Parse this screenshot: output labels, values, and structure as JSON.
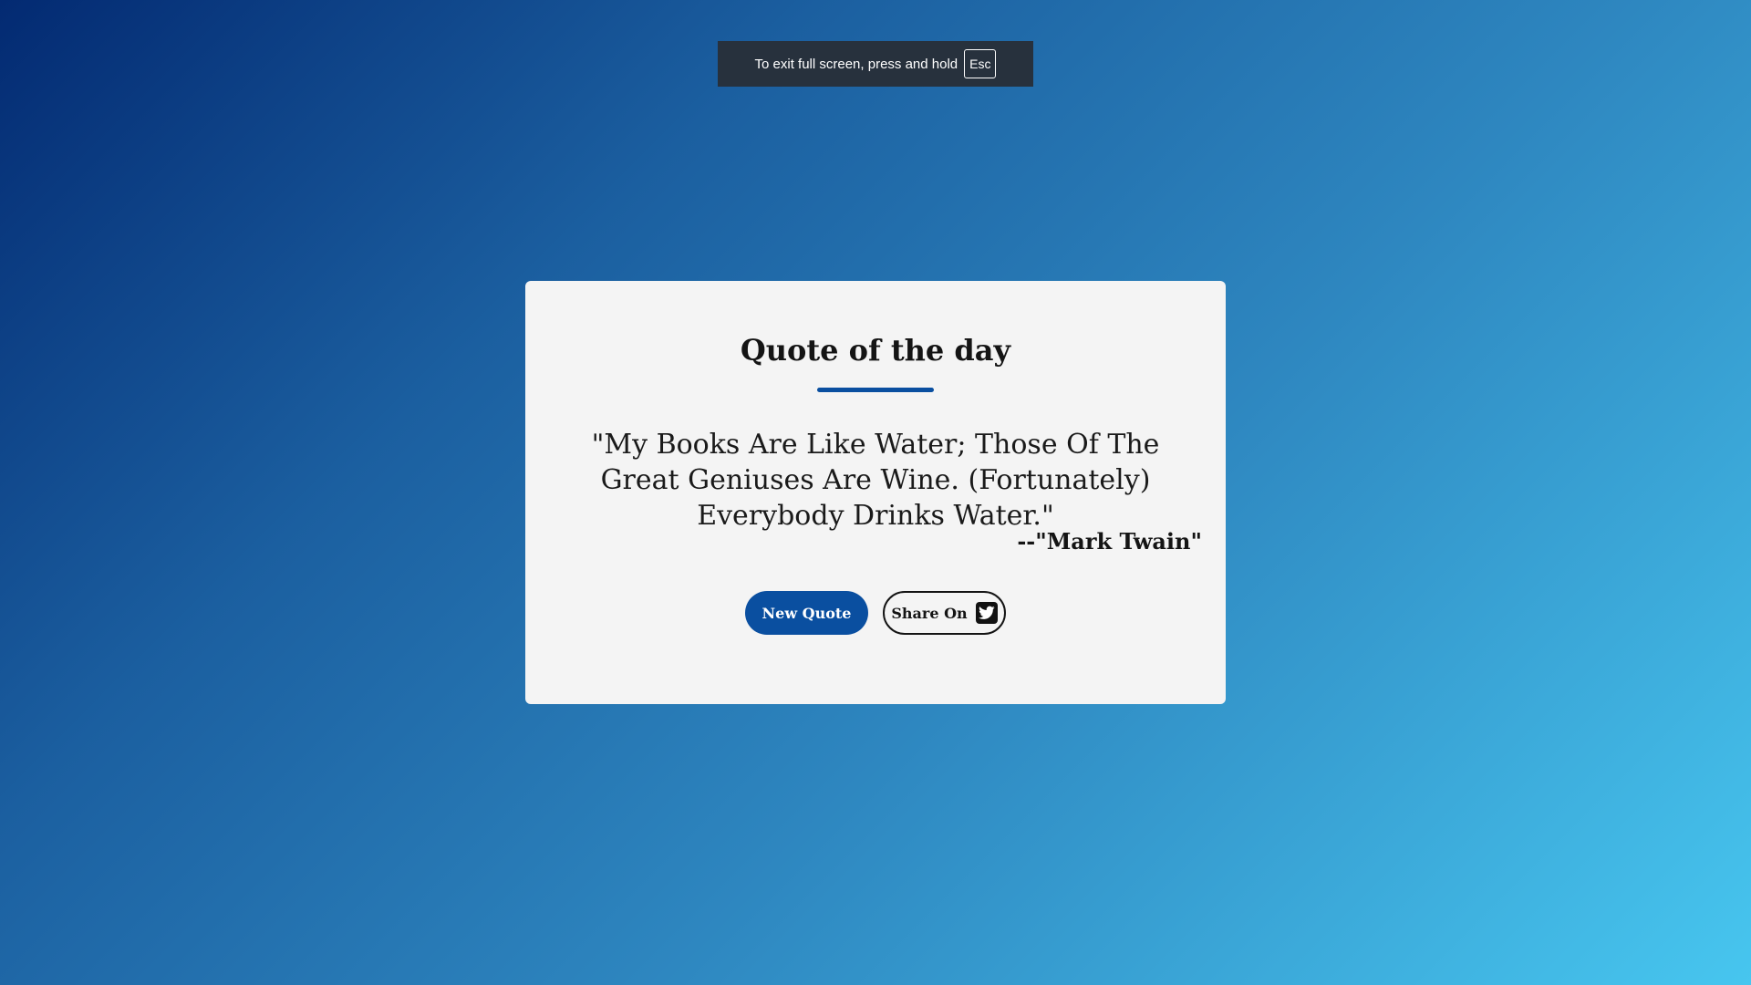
{
  "browser": {
    "fullscreen_notice": "To exit full screen, press and hold",
    "fullscreen_key": "Esc"
  },
  "card": {
    "title": "Quote of the day",
    "quote": "\"My Books Are Like Water; Those Of The Great Geniuses Are Wine. (Fortunately) Everybody Drinks Water.\"",
    "author": "--\"Mark Twain\"",
    "new_quote_label": "New Quote",
    "share_label": "Share On",
    "share_icon": "twitter-icon"
  },
  "colors": {
    "accent": "#0a4fa0",
    "card_background": "#f4f4f4",
    "gradient_start": "#032a72",
    "gradient_end": "#47c6ef"
  }
}
